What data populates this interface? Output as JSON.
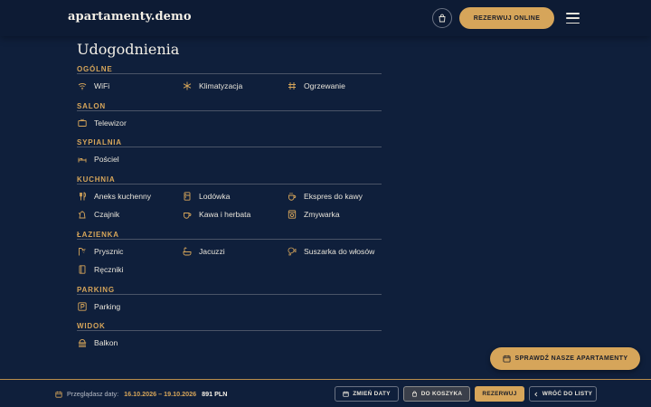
{
  "header": {
    "logo": "apartamenty.demo",
    "book_online_label": "REZERWUJ ONLINE"
  },
  "page_title": "Udogodnienia",
  "sections": [
    {
      "title": "OGÓLNE",
      "items": [
        {
          "label": "WiFi",
          "icon": "wifi-icon"
        },
        {
          "label": "Klimatyzacja",
          "icon": "snowflake-icon"
        },
        {
          "label": "Ogrzewanie",
          "icon": "heating-icon"
        }
      ]
    },
    {
      "title": "SALON",
      "items": [
        {
          "label": "Telewizor",
          "icon": "tv-icon"
        }
      ]
    },
    {
      "title": "SYPIALNIA",
      "items": [
        {
          "label": "Pościel",
          "icon": "bed-icon"
        }
      ]
    },
    {
      "title": "KUCHNIA",
      "items": [
        {
          "label": "Aneks kuchenny",
          "icon": "cutlery-icon"
        },
        {
          "label": "Lodówka",
          "icon": "fridge-icon"
        },
        {
          "label": "Ekspres do kawy",
          "icon": "coffee-machine-icon"
        },
        {
          "label": "Czajnik",
          "icon": "kettle-icon"
        },
        {
          "label": "Kawa i herbata",
          "icon": "cup-icon"
        },
        {
          "label": "Zmywarka",
          "icon": "dishwasher-icon"
        }
      ]
    },
    {
      "title": "ŁAZIENKA",
      "items": [
        {
          "label": "Prysznic",
          "icon": "shower-icon"
        },
        {
          "label": "Jacuzzi",
          "icon": "bathtub-icon"
        },
        {
          "label": "Suszarka do włosów",
          "icon": "hairdryer-icon"
        },
        {
          "label": "Ręczniki",
          "icon": "towel-icon"
        }
      ]
    },
    {
      "title": "PARKING",
      "items": [
        {
          "label": "Parking",
          "icon": "parking-icon"
        }
      ]
    },
    {
      "title": "WIDOK",
      "items": [
        {
          "label": "Balkon",
          "icon": "balcony-icon"
        }
      ]
    }
  ],
  "check_apartments_label": "SPRAWDŹ NASZE APARTAMENTY",
  "footer": {
    "browsing_label": "Przeglądasz daty:",
    "dates": "16.10.2026 – 19.10.2026",
    "price": "891 PLN",
    "change_dates_label": "ZMIEŃ DATY",
    "to_cart_label": "DO KOSZYKA",
    "book_label": "REZERWUJ",
    "back_label": "WRÓĆ DO LISTY"
  },
  "colors": {
    "background": "#0f1f3b",
    "accent": "#d6a55a",
    "text": "#e8e4da"
  }
}
